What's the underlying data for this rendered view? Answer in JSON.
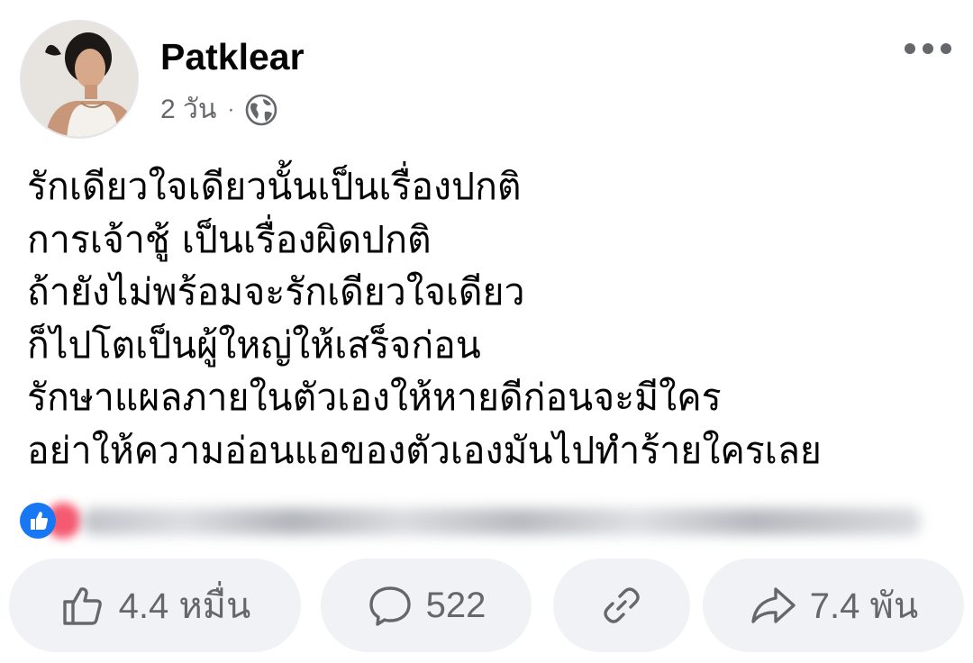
{
  "post": {
    "author": "Patklear",
    "time": "2 วัน",
    "separator": "·",
    "privacy_icon": "globe-icon",
    "menu_icon": "more-horizontal-icon",
    "body_lines": [
      "รักเดียวใจเดียวนั้นเป็นเรื่องปกติ",
      "การเจ้าชู้ เป็นเรื่องผิดปกติ",
      "ถ้ายังไม่พร้อมจะรักเดียวใจเดียว",
      "ก็ไปโตเป็นผู้ใหญ่ให้เสร็จก่อน",
      "รักษาแผลภายในตัวเองให้หายดีก่อนจะมีใคร",
      "อย่าให้ความอ่อนแอของตัวเองมันไปทำร้ายใครเลย"
    ]
  },
  "reactions": {
    "icons": [
      "like-reaction-icon",
      "love-reaction-icon"
    ],
    "colors": {
      "like": "#1877f2",
      "love": "#f33e58"
    }
  },
  "actions": {
    "like_count": "4.4 หมื่น",
    "comment_count": "522",
    "share_count": "7.4 พัน",
    "icons": [
      "thumbs-up-icon",
      "comment-bubble-icon",
      "link-icon",
      "share-arrow-icon"
    ]
  },
  "colors": {
    "text": "#050505",
    "secondary": "#65676b",
    "button_bg": "#f0f2f5"
  }
}
